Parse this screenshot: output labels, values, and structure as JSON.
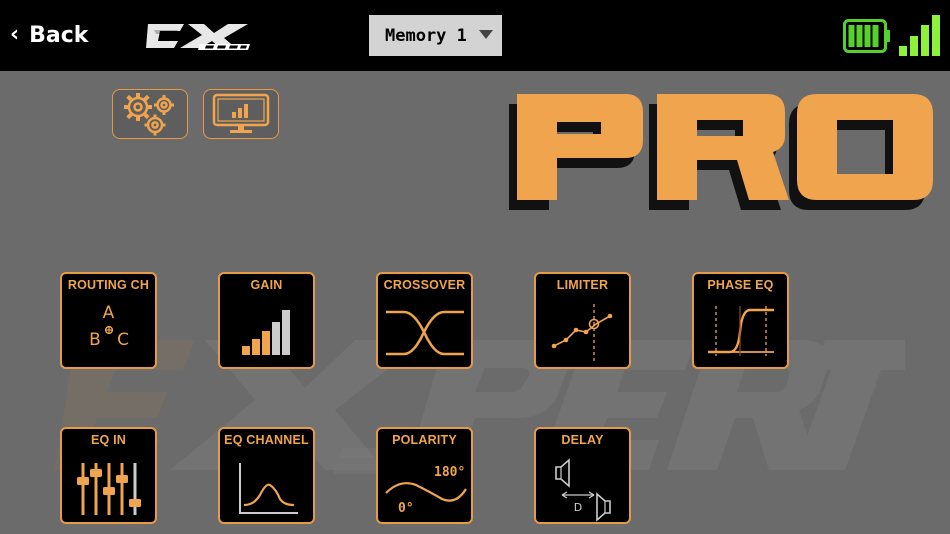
{
  "header": {
    "back_label": "Back",
    "memory": {
      "selected": "Memory 1"
    },
    "battery_level": 1.0,
    "signal_bars": 4
  },
  "top_buttons": [
    {
      "icon": "gears-icon"
    },
    {
      "icon": "monitor-chart-icon"
    }
  ],
  "tiles": [
    {
      "title": "ROUTING CH",
      "icon": "routing-icon",
      "text": {
        "a": "A",
        "b": "B",
        "c": "C"
      }
    },
    {
      "title": "GAIN",
      "icon": "gain-bars-icon"
    },
    {
      "title": "CROSSOVER",
      "icon": "crossover-icon"
    },
    {
      "title": "LIMITER",
      "icon": "limiter-icon"
    },
    {
      "title": "PHASE EQ",
      "icon": "phase-eq-icon"
    },
    {
      "title": "EQ IN",
      "icon": "eq-sliders-icon"
    },
    {
      "title": "EQ CHANNEL",
      "icon": "eq-channel-icon"
    },
    {
      "title": "POLARITY",
      "icon": "polarity-icon",
      "text": {
        "deg_high": "180°",
        "deg_low": "0°"
      }
    },
    {
      "title": "DELAY",
      "icon": "delay-speakers-icon",
      "text": {
        "d": "D"
      }
    }
  ],
  "colors": {
    "accent": "#f0a44e",
    "border": "#e69a45",
    "background": "#6b6b6b",
    "battery_green": "#55d12e",
    "signal_green": "#8ff23a"
  }
}
